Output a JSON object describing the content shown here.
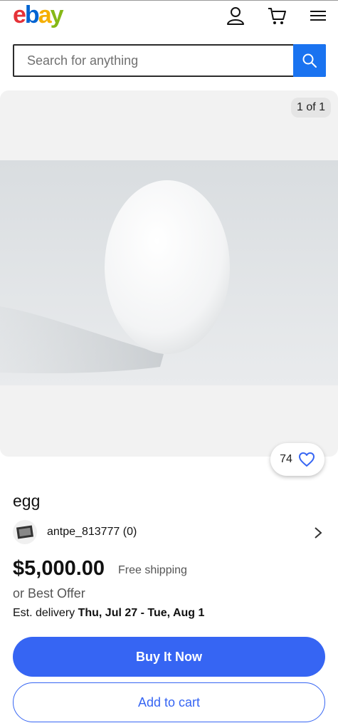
{
  "header": {
    "logo": {
      "e": "e",
      "b": "b",
      "a": "a",
      "y": "y"
    },
    "icons": [
      "account-icon",
      "cart-icon",
      "menu-icon"
    ]
  },
  "search": {
    "placeholder": "Search for anything",
    "value": ""
  },
  "gallery": {
    "counter": "1 of 1",
    "image": "white egg on light gray background"
  },
  "watch": {
    "count": "74"
  },
  "listing": {
    "title": "egg",
    "seller": "antpe_813777 (0)",
    "price": "$5,000.00",
    "shipping": "Free shipping",
    "best_offer": "or Best Offer",
    "est_label": "Est. delivery",
    "est_dates": "Thu, Jul 27 - Tue, Aug 1"
  },
  "actions": {
    "buy_now": "Buy It Now",
    "add_to_cart": "Add to cart"
  },
  "colors": {
    "accent": "#3665f3",
    "search_button": "#1a73f0"
  }
}
